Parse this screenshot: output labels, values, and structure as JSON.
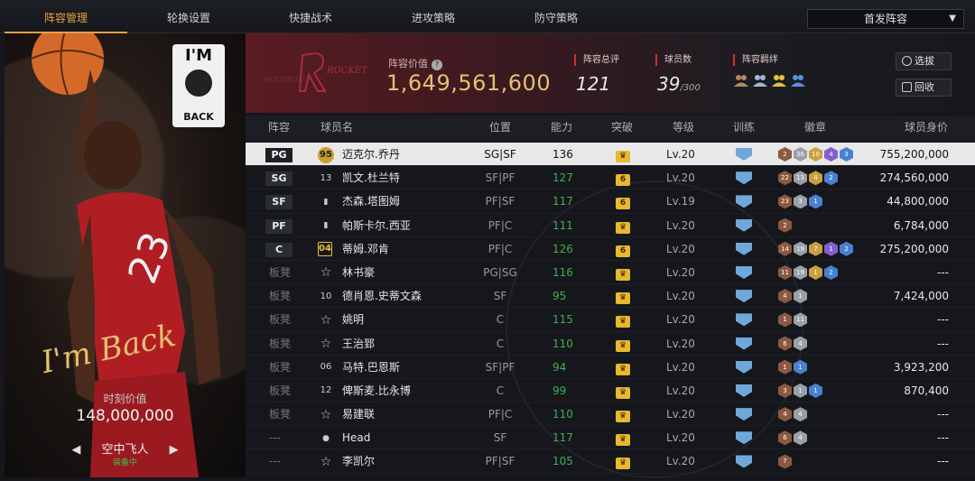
{
  "tabs": [
    {
      "label": "阵容管理",
      "active": true
    },
    {
      "label": "轮换设置",
      "active": false
    },
    {
      "label": "快捷战术",
      "active": false
    },
    {
      "label": "进攻策略",
      "active": false
    },
    {
      "label": "防守策略",
      "active": false
    }
  ],
  "lineup_select": {
    "value": "首发阵容"
  },
  "hero": {
    "badge_top": "I'M",
    "badge_bottom": "BACK",
    "signature": "I'm Back",
    "moment_label": "时刻价值",
    "moment_value": "148,000,000",
    "skin_name": "空中飞人",
    "skin_status": "装备中"
  },
  "team": {
    "logo_text": "HOUSTON ROCKETS",
    "value_label": "阵容价值",
    "value": "1,649,561,600",
    "rating_label": "阵容总评",
    "rating": "121",
    "players_label": "球员数",
    "players": "39",
    "players_max": "/300",
    "chem_label": "阵容羁绊",
    "chem_colors": [
      "#b08a60",
      "#a0b8d8",
      "#e8c040",
      "#5a90e0"
    ]
  },
  "buttons": {
    "draft": "选拔",
    "recall": "回收"
  },
  "table": {
    "headers": {
      "slot": "阵容",
      "name": "球员名",
      "position": "位置",
      "power": "能力",
      "breakthrough": "突破",
      "level": "等级",
      "training": "训练",
      "badges": "徽章",
      "worth": "球员身价"
    },
    "rows": [
      {
        "slot": "PG",
        "starter": true,
        "num": "95",
        "num_style": "gold",
        "name": "迈克尔.乔丹",
        "pos": "SG|SF",
        "power": "136",
        "brk": "",
        "lvl": "Lv.20",
        "badges": [
          [
            "2",
            "b-bronze"
          ],
          [
            "36",
            "b-silver"
          ],
          [
            "10",
            "b-gold"
          ],
          [
            "4",
            "b-purple"
          ],
          [
            "3",
            "b-blue"
          ]
        ],
        "worth": "755,200,000"
      },
      {
        "slot": "SG",
        "starter": true,
        "num": "13",
        "num_style": "",
        "name": "凯文.杜兰特",
        "pos": "SF|PF",
        "power": "127",
        "brk": "6",
        "lvl": "Lv.20",
        "badges": [
          [
            "22",
            "b-bronze"
          ],
          [
            "13",
            "b-silver"
          ],
          [
            "4",
            "b-gold"
          ],
          [
            "2",
            "b-blue"
          ]
        ],
        "worth": "274,560,000"
      },
      {
        "slot": "SF",
        "starter": true,
        "num": "bars",
        "num_style": "",
        "name": "杰森.塔图姆",
        "pos": "PF|SF",
        "power": "117",
        "brk": "6",
        "lvl": "Lv.19",
        "badges": [
          [
            "23",
            "b-bronze"
          ],
          [
            "3",
            "b-silver"
          ],
          [
            "1",
            "b-blue"
          ]
        ],
        "worth": "44,800,000"
      },
      {
        "slot": "PF",
        "starter": true,
        "num": "bars",
        "num_style": "",
        "name": "帕斯卡尔.西亚",
        "pos": "PF|C",
        "power": "111",
        "brk": "",
        "lvl": "Lv.20",
        "badges": [
          [
            "2",
            "b-bronze"
          ]
        ],
        "worth": "6,784,000"
      },
      {
        "slot": "C",
        "starter": true,
        "num": "04",
        "num_style": "yellow",
        "name": "蒂姆.邓肯",
        "pos": "PF|C",
        "power": "126",
        "brk": "6",
        "lvl": "Lv.20",
        "badges": [
          [
            "14",
            "b-bronze"
          ],
          [
            "19",
            "b-silver"
          ],
          [
            "7",
            "b-gold"
          ],
          [
            "1",
            "b-purple"
          ],
          [
            "2",
            "b-blue"
          ]
        ],
        "worth": "275,200,000"
      },
      {
        "slot": "板凳",
        "starter": false,
        "num": "star",
        "num_style": "",
        "name": "林书豪",
        "pos": "PG|SG",
        "power": "116",
        "brk": "",
        "lvl": "Lv.20",
        "badges": [
          [
            "11",
            "b-bronze"
          ],
          [
            "19",
            "b-silver"
          ],
          [
            "1",
            "b-gold"
          ],
          [
            "2",
            "b-blue"
          ]
        ],
        "worth": "---"
      },
      {
        "slot": "板凳",
        "starter": false,
        "num": "10",
        "num_style": "",
        "name": "德肖恩.史蒂文森",
        "pos": "SF",
        "power": "95",
        "brk": "",
        "lvl": "Lv.20",
        "badges": [
          [
            "4",
            "b-bronze"
          ],
          [
            "1",
            "b-silver"
          ]
        ],
        "worth": "7,424,000"
      },
      {
        "slot": "板凳",
        "starter": false,
        "num": "star",
        "num_style": "",
        "name": "姚明",
        "pos": "C",
        "power": "115",
        "brk": "",
        "lvl": "Lv.20",
        "badges": [
          [
            "1",
            "b-bronze"
          ],
          [
            "11",
            "b-silver"
          ]
        ],
        "worth": "---"
      },
      {
        "slot": "板凳",
        "starter": false,
        "num": "star",
        "num_style": "",
        "name": "王治郅",
        "pos": "C",
        "power": "110",
        "brk": "",
        "lvl": "Lv.20",
        "badges": [
          [
            "6",
            "b-bronze"
          ],
          [
            "4",
            "b-silver"
          ]
        ],
        "worth": "---"
      },
      {
        "slot": "板凳",
        "starter": false,
        "num": "06",
        "num_style": "",
        "name": "马特.巴恩斯",
        "pos": "SF|PF",
        "power": "94",
        "brk": "",
        "lvl": "Lv.20",
        "badges": [
          [
            "1",
            "b-bronze"
          ],
          [
            "1",
            "b-blue"
          ]
        ],
        "worth": "3,923,200"
      },
      {
        "slot": "板凳",
        "starter": false,
        "num": "12",
        "num_style": "",
        "name": "俾斯麦.比永博",
        "pos": "C",
        "power": "99",
        "brk": "",
        "lvl": "Lv.20",
        "badges": [
          [
            "3",
            "b-bronze"
          ],
          [
            "1",
            "b-silver"
          ],
          [
            "1",
            "b-blue"
          ]
        ],
        "worth": "870,400"
      },
      {
        "slot": "板凳",
        "starter": false,
        "num": "star",
        "num_style": "",
        "name": "易建联",
        "pos": "PF|C",
        "power": "110",
        "brk": "",
        "lvl": "Lv.20",
        "badges": [
          [
            "4",
            "b-bronze"
          ],
          [
            "4",
            "b-silver"
          ]
        ],
        "worth": "---"
      },
      {
        "slot": "---",
        "starter": false,
        "num": "person",
        "num_style": "",
        "name": "Head",
        "pos": "SF",
        "power": "117",
        "brk": "",
        "lvl": "Lv.20",
        "badges": [
          [
            "6",
            "b-bronze"
          ],
          [
            "4",
            "b-silver"
          ]
        ],
        "worth": "---"
      },
      {
        "slot": "---",
        "starter": false,
        "num": "star",
        "num_style": "",
        "name": "李凯尔",
        "pos": "PF|SF",
        "power": "105",
        "brk": "",
        "lvl": "Lv.20",
        "badges": [
          [
            "7",
            "b-bronze"
          ]
        ],
        "worth": "---"
      }
    ]
  }
}
